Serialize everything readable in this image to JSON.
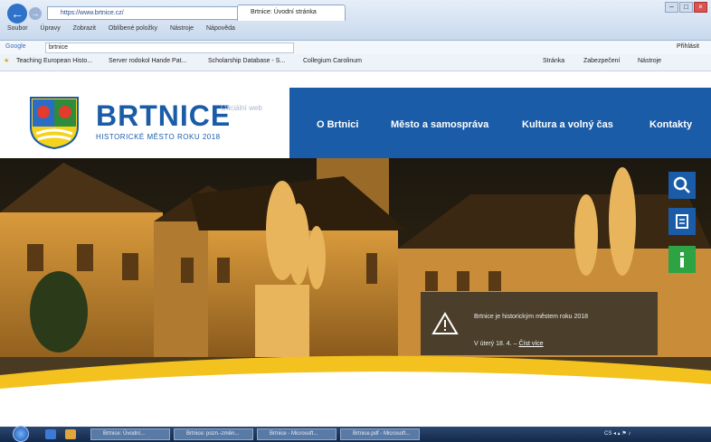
{
  "browser": {
    "address": "https://www.brtnice.cz/",
    "tab_title": "Brtnice: Úvodní stránka",
    "menu": [
      "Soubor",
      "Úpravy",
      "Zobrazit",
      "Oblíbené položky",
      "Nástroje",
      "Nápověda"
    ],
    "search_engine": "Google",
    "search_value": "brtnice",
    "search_right": "Přihlásit",
    "favorites": [
      "Teaching European Histo...",
      "Server rodokol Hande Pat...",
      "Scholarship Database - S...",
      "Collegium Carolinum"
    ],
    "toolbar_right": [
      "Stránka",
      "Zabezpečení",
      "Nástroje"
    ]
  },
  "site": {
    "name": "BRTNICE",
    "tagline": "Oficiální web",
    "subtitle": "HISTORICKÉ MĚSTO ROKU 2018",
    "nav": [
      "O Brtnici",
      "Město a samospráva",
      "Kultura a volný čas",
      "Kontakty"
    ]
  },
  "hero": {
    "panel_line1": "Brtnice je historickým městem roku 2018",
    "panel_line2": "V úterý 18. 4. –",
    "panel_link": "Číst více",
    "scroll_glyph": "⌄"
  },
  "taskbar": {
    "windows": [
      "Brtnice: Úvodní...",
      "Brtnice: pozn.-změn...",
      "Brtnice - Microsoft...",
      "Brtnice.pdf - Microsoft..."
    ],
    "tray": "CS ◂ ▴ ⚑ ♪"
  },
  "colors": {
    "brand_blue": "#1a5ca8",
    "info_green": "#2ea344",
    "hero_yellow": "#f3c21f"
  }
}
